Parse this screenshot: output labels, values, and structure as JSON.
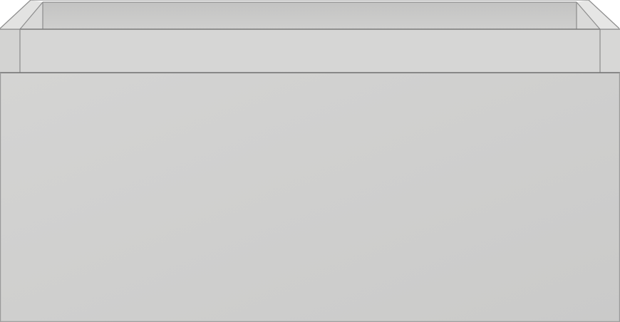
{
  "image": {
    "subject": "drawer-unit",
    "colors": {
      "background": "#ffffff",
      "front": "#d2d2d1",
      "front_shade": "#cacac9",
      "inner_back": "#c7c7c6",
      "inner_floor": "#d9d9d8",
      "side_left": "#d5d5d4",
      "side_right": "#d8d8d7",
      "rim_top": "#e2e2e1",
      "edge": "#8f8f8f",
      "edge_dark": "#6d6d6d"
    }
  }
}
